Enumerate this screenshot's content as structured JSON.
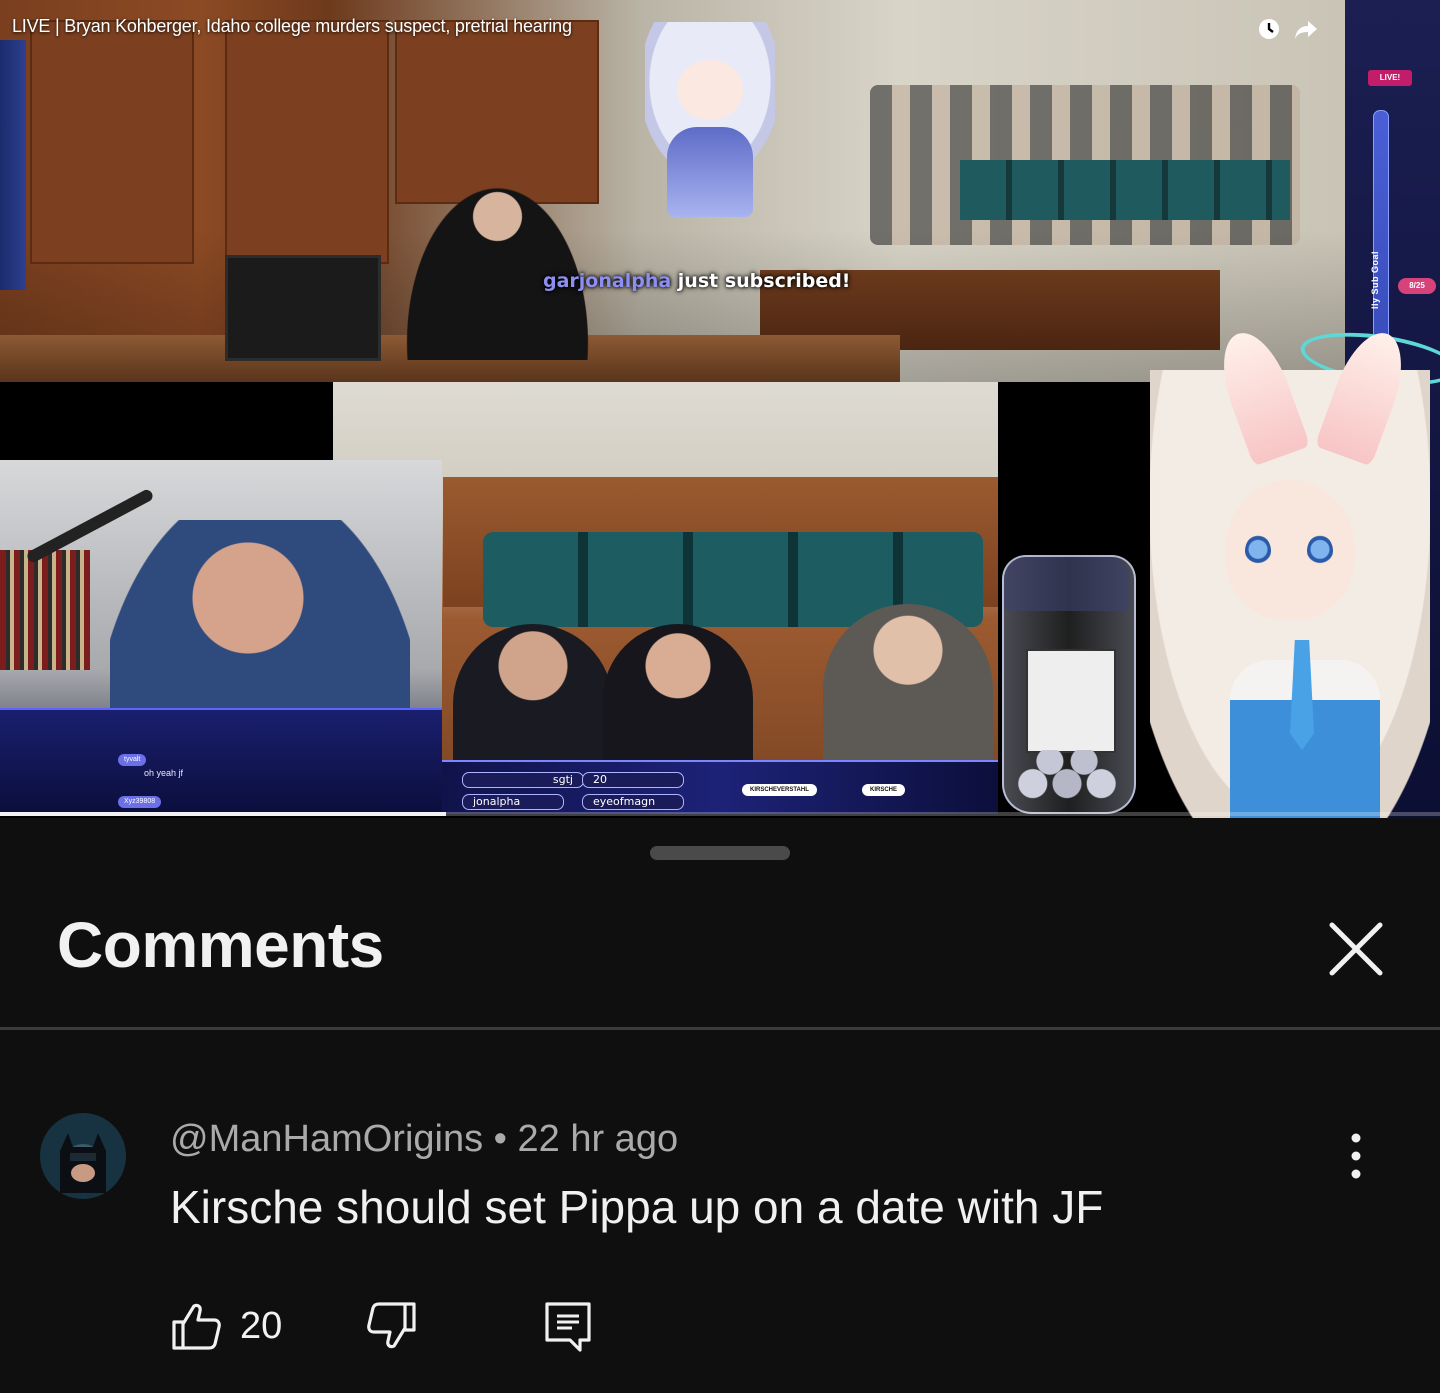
{
  "video": {
    "title": "LIVE | Bryan Kohberger, Idaho college murders suspect, pretrial hearing",
    "sub_alert": {
      "name": "garjonalpha",
      "text": " just subscribed!"
    },
    "overlay": {
      "live_badge": "LIVE!",
      "goal_label": "lly Sub Goal",
      "goal_count": "8/25",
      "chat_lines": [
        {
          "user": "tyvalt",
          "text": "oh yeah jf"
        },
        {
          "user": "Xyz39808",
          "text": ""
        }
      ],
      "bottom_users": [
        "sgtj",
        "20",
        "jonalpha",
        "eyeofmagn"
      ],
      "socials": [
        "KIRSCHEVERSTAHL",
        "KIRSCHE"
      ]
    },
    "progress_fraction": 0.31,
    "icons": {
      "clock": "clock-icon",
      "share": "share-icon"
    }
  },
  "comments": {
    "title": "Comments",
    "close_icon": "close-icon",
    "items": [
      {
        "author": "@ManHamOrigins",
        "separator": " • ",
        "time": "22 hr ago",
        "text": "Kirsche should set Pippa up on a date with JF",
        "likes": "20",
        "icons": [
          "like-icon",
          "dislike-icon",
          "reply-icon",
          "more-vert-icon"
        ]
      }
    ]
  },
  "colors": {
    "background": "#0f0f0f",
    "text_primary": "#f1f1f1",
    "text_secondary": "#aaaaaa",
    "divider": "#3a3a3a",
    "sub_name": "#8d8ff0"
  }
}
